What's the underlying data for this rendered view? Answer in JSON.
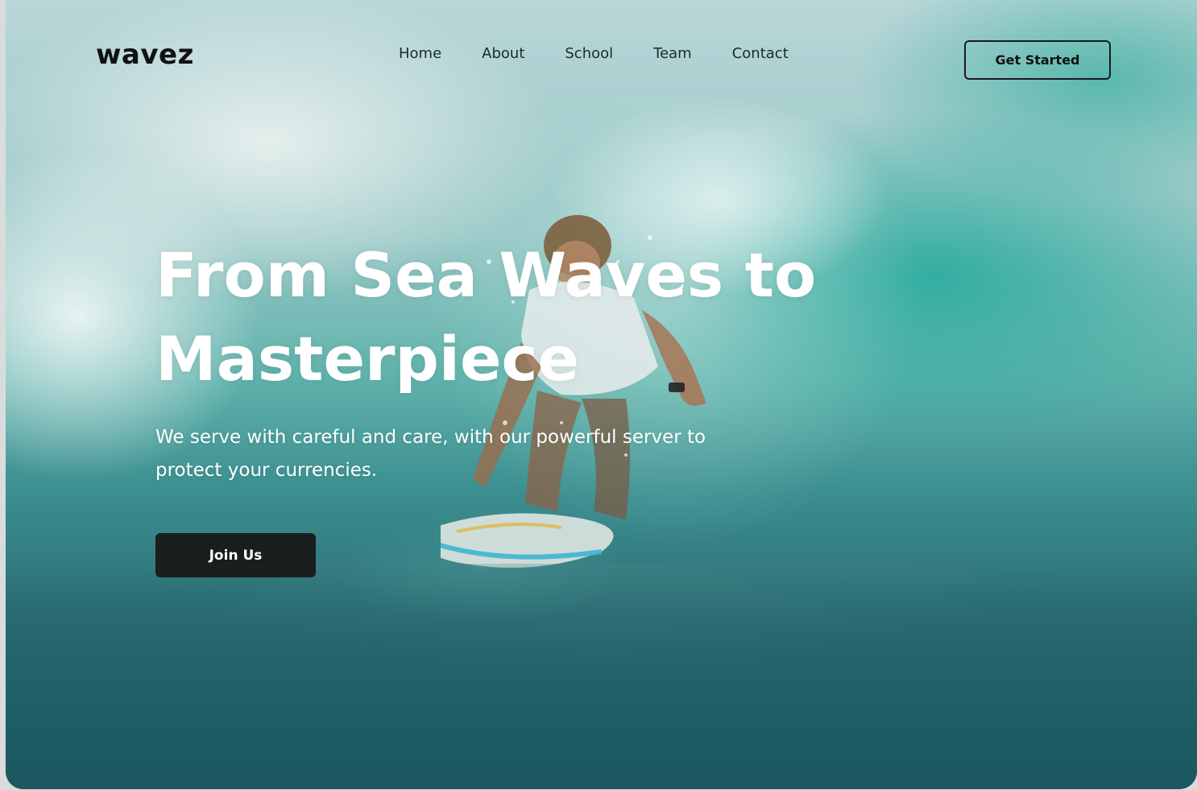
{
  "brand": {
    "logo_text": "wavez"
  },
  "nav": {
    "items": [
      {
        "label": "Home"
      },
      {
        "label": "About"
      },
      {
        "label": "School"
      },
      {
        "label": "Team"
      },
      {
        "label": "Contact"
      }
    ],
    "cta_label": "Get Started"
  },
  "hero": {
    "headline_line1": "From Sea Waves to",
    "headline_line2": "Masterpiece",
    "subtitle_line1": "We serve with careful and care, with our powerful server to",
    "subtitle_line2": "protect your currencies.",
    "button_label": "Join Us",
    "image": "surfer-in-wave-photo"
  },
  "colors": {
    "button_dark": "#1b1e1f",
    "text_dark": "#111111",
    "headline": "#ffffff",
    "wave_teal": "#2fa99a"
  }
}
